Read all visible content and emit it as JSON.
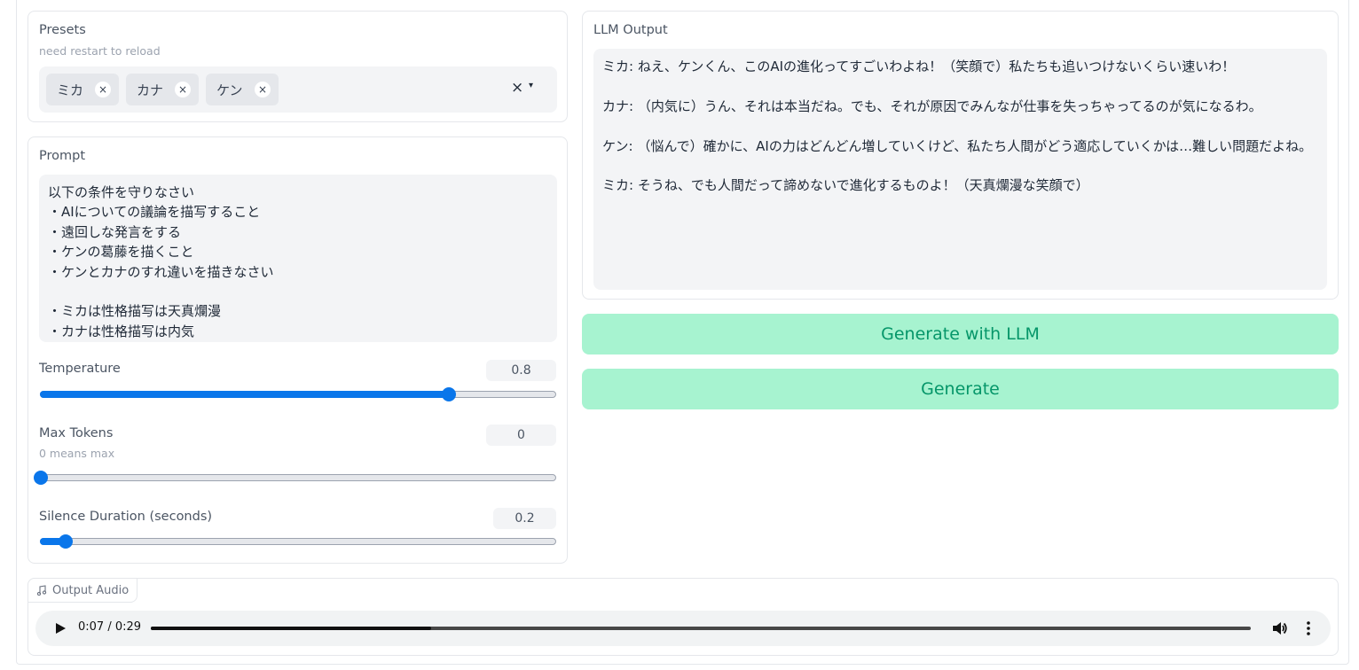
{
  "presets": {
    "label": "Presets",
    "info": "need restart to reload",
    "selected": [
      {
        "label": "ミカ"
      },
      {
        "label": "カナ"
      },
      {
        "label": "ケン"
      }
    ],
    "remove_glyph": "×",
    "clear_glyph": "×",
    "arrow_glyph": "▾"
  },
  "prompt": {
    "label": "Prompt",
    "value": "以下の条件を守りなさい\n・AIについての議論を描写すること\n・遠回しな発言をする\n・ケンの葛藤を描くこと\n・ケンとカナのすれ違いを描きなさい\n\n・ミカは性格描写は天真爛漫\n・カナは性格描写は内気"
  },
  "sliders": {
    "temperature": {
      "label": "Temperature",
      "value": "0.8",
      "fraction": 0.793
    },
    "max_tokens": {
      "label": "Max Tokens",
      "info": "0 means max",
      "value": "0",
      "fraction": 0.0
    },
    "silence": {
      "label": "Silence Duration (seconds)",
      "value": "0.2",
      "fraction": 0.048
    }
  },
  "llm_output": {
    "label": "LLM Output",
    "value": "ミカ: ねえ、ケンくん、このAIの進化ってすごいわよね！（笑顔で）私たちも追いつけないくらい速いわ！\n\nカナ: （内気に）うん、それは本当だね。でも、それが原因でみんなが仕事を失っちゃってるのが気になるわ。\n\nケン: （悩んで）確かに、AIの力はどんどん増していくけど、私たち人間がどう適応していくかは…難しい問題だよね。\n\nミカ: そうね、でも人間だって諦めないで進化するものよ！（天真爛漫な笑顔で）"
  },
  "buttons": {
    "generate_llm": "Generate with LLM",
    "generate": "Generate"
  },
  "audio": {
    "label": "Output Audio",
    "time": "0:07 / 0:29",
    "progress": 0.255
  },
  "colors": {
    "accent": "#0a76ea",
    "button_bg": "#a7f3d0",
    "button_text": "#059669"
  }
}
